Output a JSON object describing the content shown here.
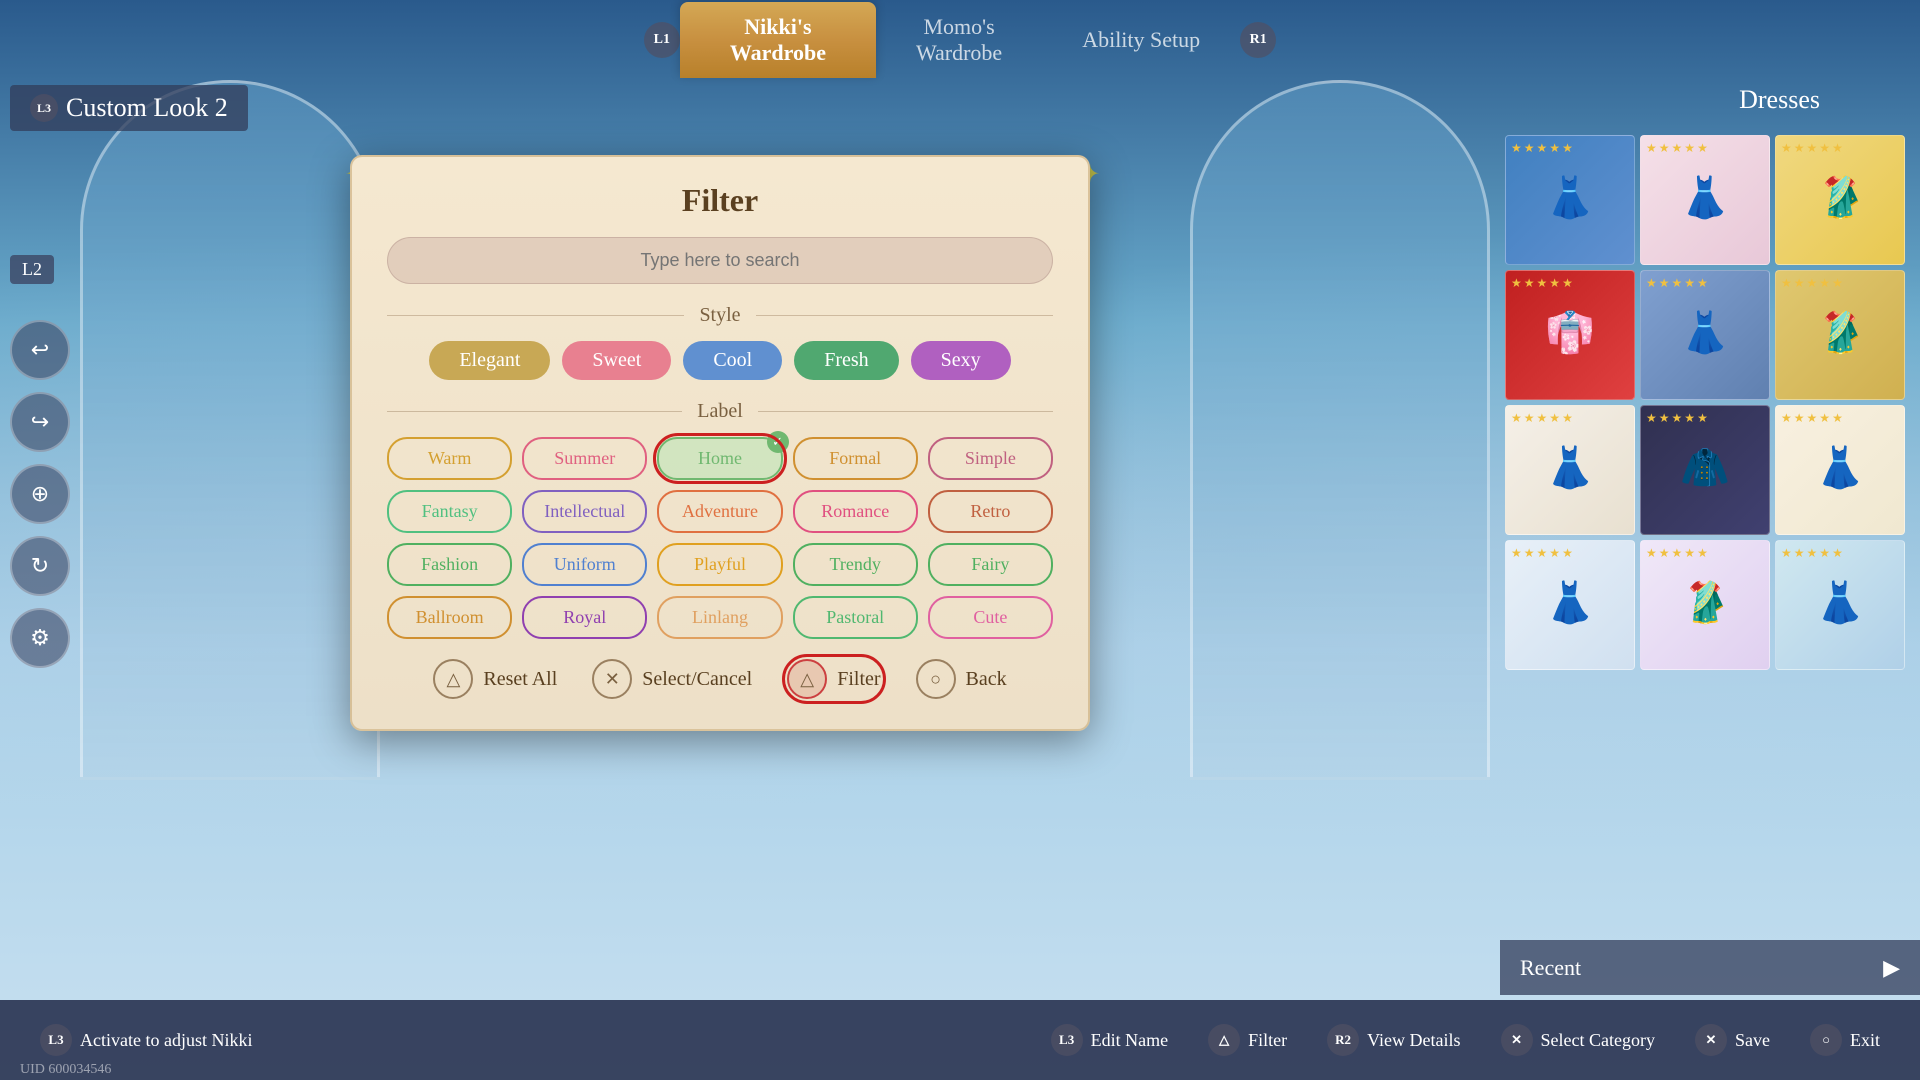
{
  "header": {
    "nikki_wardrobe": "Nikki's\nWardrobe",
    "momo_wardrobe": "Momo's\nWardrobe",
    "ability_setup": "Ability Setup",
    "l1": "L1",
    "r1": "R1"
  },
  "custom_look": {
    "badge": "L3",
    "label": "Custom Look 2"
  },
  "dresses_label": "Dresses",
  "filter": {
    "title": "Filter",
    "search_placeholder": "Type here to search",
    "style_section": "Style",
    "label_section": "Label",
    "style_buttons": [
      {
        "id": "elegant",
        "label": "Elegant",
        "class": "elegant"
      },
      {
        "id": "sweet",
        "label": "Sweet",
        "class": "sweet"
      },
      {
        "id": "cool",
        "label": "Cool",
        "class": "cool"
      },
      {
        "id": "fresh",
        "label": "Fresh",
        "class": "fresh"
      },
      {
        "id": "sexy",
        "label": "Sexy",
        "class": "sexy"
      }
    ],
    "label_buttons": [
      {
        "id": "warm",
        "label": "Warm",
        "class": "warm",
        "selected": false
      },
      {
        "id": "summer",
        "label": "Summer",
        "class": "summer",
        "selected": false
      },
      {
        "id": "home",
        "label": "Home",
        "class": "home",
        "selected": true
      },
      {
        "id": "formal",
        "label": "Formal",
        "class": "formal",
        "selected": false
      },
      {
        "id": "simple",
        "label": "Simple",
        "class": "simple",
        "selected": false
      },
      {
        "id": "fantasy",
        "label": "Fantasy",
        "class": "fantasy",
        "selected": false
      },
      {
        "id": "intellectual",
        "label": "Intellectual",
        "class": "intellectual",
        "selected": false
      },
      {
        "id": "adventure",
        "label": "Adventure",
        "class": "adventure",
        "selected": false
      },
      {
        "id": "romance",
        "label": "Romance",
        "class": "romance",
        "selected": false
      },
      {
        "id": "retro",
        "label": "Retro",
        "class": "retro",
        "selected": false
      },
      {
        "id": "fashion",
        "label": "Fashion",
        "class": "fashion",
        "selected": false
      },
      {
        "id": "uniform",
        "label": "Uniform",
        "class": "uniform",
        "selected": false
      },
      {
        "id": "playful",
        "label": "Playful",
        "class": "playful",
        "selected": false
      },
      {
        "id": "trendy",
        "label": "Trendy",
        "class": "trendy",
        "selected": false
      },
      {
        "id": "fairy",
        "label": "Fairy",
        "class": "fairy",
        "selected": false
      },
      {
        "id": "ballroom",
        "label": "Ballroom",
        "class": "ballroom",
        "selected": false
      },
      {
        "id": "royal",
        "label": "Royal",
        "class": "royal",
        "selected": false
      },
      {
        "id": "linlang",
        "label": "Linlang",
        "class": "linlang",
        "selected": false
      },
      {
        "id": "pastoral",
        "label": "Pastoral",
        "class": "pastoral",
        "selected": false
      },
      {
        "id": "cute",
        "label": "Cute",
        "class": "cute",
        "selected": false
      }
    ],
    "actions": [
      {
        "id": "reset",
        "icon": "△",
        "label": "Reset All"
      },
      {
        "id": "select_cancel",
        "icon": "✕",
        "label": "Select/Cancel"
      },
      {
        "id": "filter",
        "icon": "△",
        "label": "Filter"
      },
      {
        "id": "back",
        "icon": "○",
        "label": "Back"
      }
    ]
  },
  "bottom_bar": {
    "l3_badge": "L3",
    "activate_text": "Activate to adjust Nikki",
    "uid": "UID 600034546",
    "items": [
      {
        "id": "edit_name",
        "badge": "L3",
        "label": "Edit Name"
      },
      {
        "id": "filter_btn",
        "badge": "△",
        "label": "Filter"
      },
      {
        "id": "view_details",
        "badge": "R2",
        "label": "View Details"
      },
      {
        "id": "select_category",
        "badge": "✕",
        "label": "Select Category"
      },
      {
        "id": "save",
        "badge": "✕",
        "label": "Save"
      },
      {
        "id": "exit",
        "badge": "○",
        "label": "Exit"
      }
    ]
  },
  "recent": {
    "label": "Recent"
  },
  "dress_thumbnails": [
    {
      "id": 1,
      "class": "dress-1",
      "stars": 5
    },
    {
      "id": 2,
      "class": "dress-2",
      "stars": 5
    },
    {
      "id": 3,
      "class": "dress-3",
      "stars": 5
    },
    {
      "id": 4,
      "class": "dress-4",
      "stars": 5
    },
    {
      "id": 5,
      "class": "dress-5",
      "stars": 5
    },
    {
      "id": 6,
      "class": "dress-6",
      "stars": 5
    },
    {
      "id": 7,
      "class": "dress-7",
      "stars": 5
    },
    {
      "id": 8,
      "class": "dress-8",
      "stars": 5
    },
    {
      "id": 9,
      "class": "dress-9",
      "stars": 5
    },
    {
      "id": 10,
      "class": "dress-10",
      "stars": 5
    },
    {
      "id": 11,
      "class": "dress-11",
      "stars": 5
    },
    {
      "id": 12,
      "class": "dress-12",
      "stars": 5
    }
  ]
}
